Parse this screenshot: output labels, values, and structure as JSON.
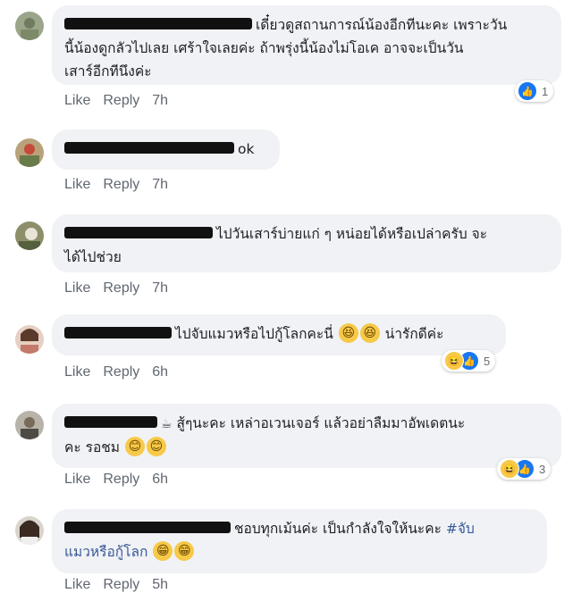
{
  "actions": {
    "like": "Like",
    "reply": "Reply"
  },
  "comments": [
    {
      "text1": "เดี๋ยวดูสถานการณ์น้องอีกทีนะคะ เพราะวัน",
      "text2": "นี้น้องดูกลัวไปเลย เศร้าใจเลยค่ะ ถ้าพรุ่งนี้น้องไม่โอเค อาจจะเป็นวัน",
      "text3": "เสาร์อีกทีนึงค่ะ",
      "time": "7h",
      "reaction_count": "1"
    },
    {
      "text1": "ok",
      "time": "7h"
    },
    {
      "text1": "ไปวันเสาร์บ่ายแก่ ๆ หน่อยได้หรือเปล่าครับ จะ",
      "text2": "ได้ไปช่วย",
      "time": "7h"
    },
    {
      "text1": "ไปจับแมวหรือไปกู้โลกคะนี่",
      "text1b": "น่ารักดีค่ะ",
      "time": "6h",
      "reaction_count": "5"
    },
    {
      "text1": "สู้ๆนะคะ เหล่าอเวนเจอร์ แล้วอย่าลืมมาอัพเดตนะ",
      "text2": "คะ รอชม",
      "time": "6h",
      "reaction_count": "3"
    },
    {
      "text1": "ชอบทุกเม้นค่ะ เป็นกำลังใจให้นะคะ",
      "hashtag": "#จับ",
      "text2": "แมวหรือกู้โลก",
      "time": "5h"
    }
  ]
}
